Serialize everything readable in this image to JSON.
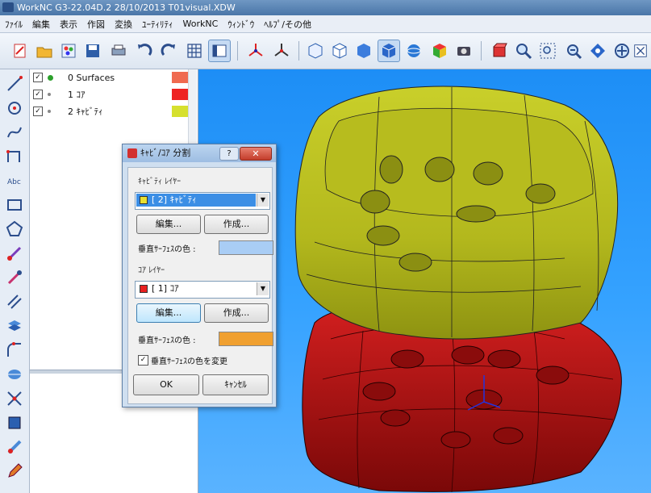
{
  "window": {
    "title": "WorkNC G3-22.04D.2   28/10/2013   T01visual.XDW"
  },
  "menu": [
    "ﾌｧｲﾙ",
    "編集",
    "表示",
    "作図",
    "変換",
    "ﾕｰﾃｨﾘﾃｨ",
    "WorkNC",
    "ｳｨﾝﾄﾞｳ",
    "ﾍﾙﾌﾟ/その他"
  ],
  "toolbar_icons": [
    "new-file-icon",
    "open-folder-icon",
    "palette-icon",
    "save-icon",
    "print-icon",
    "undo-icon",
    "redo-icon",
    "grid-icon",
    "layer-panel-icon",
    "axis-icon",
    "axis-alt-icon",
    "view-iso-icon",
    "view-front-icon",
    "view-shaded-icon",
    "view-cube-icon",
    "sphere-icon",
    "color-cube-icon",
    "camera-icon",
    "layer-box-icon",
    "zoom-icon",
    "zoom-window-icon",
    "zoom-fit-icon",
    "rotate-icon",
    "pan-icon",
    "fit-all-icon"
  ],
  "layers": [
    {
      "label": "0 Surfaces",
      "checked": true,
      "dot_color": "#2ca02c",
      "color": "#f06a50"
    },
    {
      "label": "1 ｺｱ",
      "checked": true,
      "dot_color": "#888888",
      "color": "#ee2222"
    },
    {
      "label": "2 ｷｬﾋﾞﾃｨ",
      "checked": true,
      "dot_color": "#888888",
      "color": "#d6e02e"
    }
  ],
  "dialog": {
    "title": "ｷｬﾋﾞ/ｺｱ 分割",
    "help_label": "?",
    "close_label": "✕",
    "cavity_group_label": "ｷｬﾋﾞﾃｨ ﾚｲﾔｰ",
    "cavity_combo": "[  2] ｷｬﾋﾞﾃｨ",
    "cavity_combo_color": "#e8e030",
    "edit_label": "編集...",
    "create_label": "作成...",
    "vertical_color_label": "垂直ｻｰﾌｪｽの色 :",
    "cavity_vertical_color": "#a9cdf5",
    "core_group_label": "ｺｱ ﾚｲﾔｰ",
    "core_combo": "[  1] ｺｱ",
    "core_combo_color": "#e82020",
    "core_vertical_color": "#f0a030",
    "change_color_label": "垂直ｻｰﾌｪｽの色を変更",
    "change_color_checked": true,
    "ok_label": "OK",
    "cancel_label": "ｷｬﾝｾﾙ"
  },
  "colors": {
    "viewport_bg": "#2f9bff",
    "cavity_part": "#c8cc24",
    "core_part": "#c21818"
  }
}
